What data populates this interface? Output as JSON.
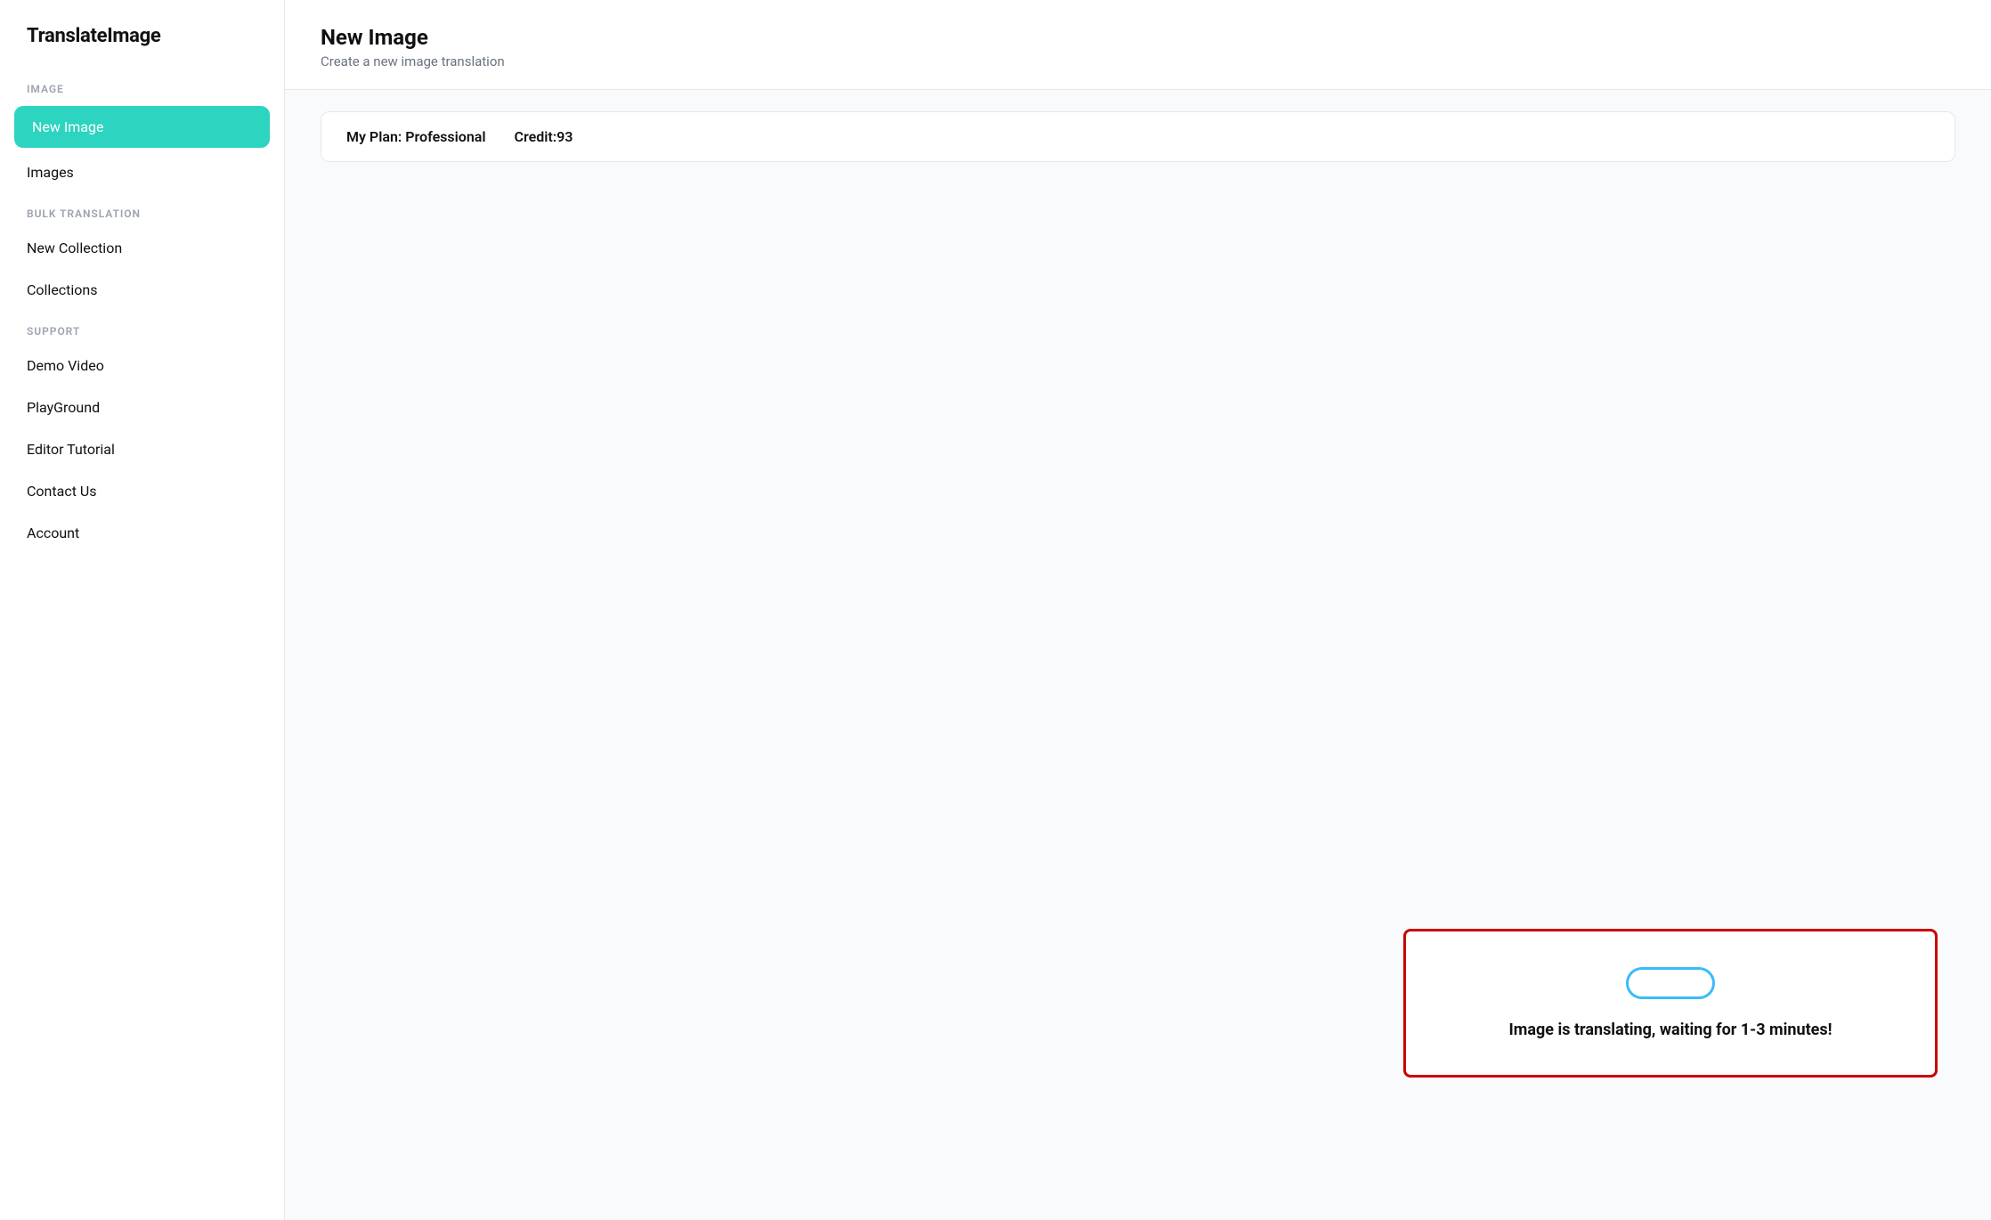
{
  "app": {
    "logo": "TranslateImage"
  },
  "sidebar": {
    "sections": [
      {
        "label": "IMAGE",
        "items": [
          {
            "id": "new-image",
            "label": "New Image",
            "active": true
          },
          {
            "id": "images",
            "label": "Images",
            "active": false
          }
        ]
      },
      {
        "label": "BULK TRANSLATION",
        "items": [
          {
            "id": "new-collection",
            "label": "New Collection",
            "active": false
          },
          {
            "id": "collections",
            "label": "Collections",
            "active": false
          }
        ]
      },
      {
        "label": "SUPPORT",
        "items": [
          {
            "id": "demo-video",
            "label": "Demo Video",
            "active": false
          },
          {
            "id": "playground",
            "label": "PlayGround",
            "active": false
          },
          {
            "id": "editor-tutorial",
            "label": "Editor Tutorial",
            "active": false
          },
          {
            "id": "contact-us",
            "label": "Contact Us",
            "active": false
          },
          {
            "id": "account",
            "label": "Account",
            "active": false
          }
        ]
      }
    ]
  },
  "page": {
    "title": "New Image",
    "subtitle": "Create a new image translation"
  },
  "plan": {
    "plan_label": "My Plan: Professional",
    "credit_label": "Credit:93"
  },
  "status": {
    "message": "Image is translating, waiting for 1-3 minutes!"
  }
}
